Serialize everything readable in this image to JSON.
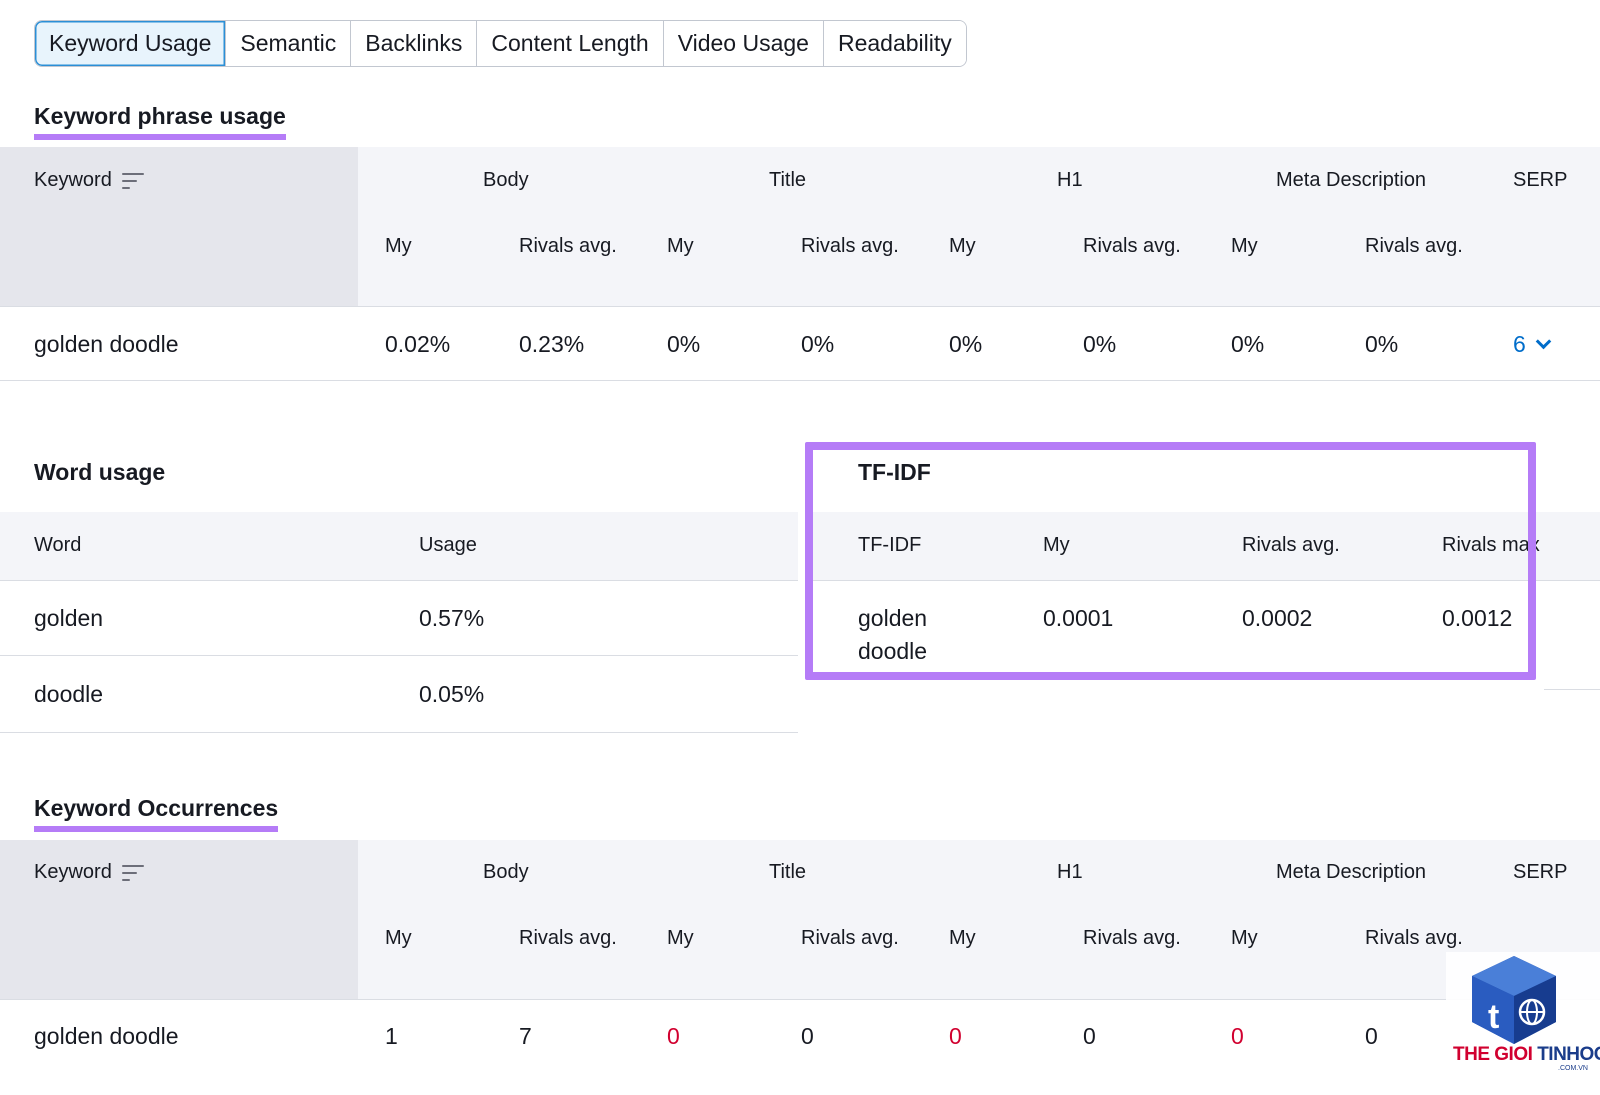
{
  "tabs": [
    "Keyword Usage",
    "Semantic",
    "Backlinks",
    "Content Length",
    "Video Usage",
    "Readability"
  ],
  "keyword_phrase_usage": {
    "title": "Keyword phrase usage",
    "keyword_header": "Keyword",
    "groups": [
      "Body",
      "Title",
      "H1",
      "Meta Description",
      "SERP"
    ],
    "sub": {
      "my": "My",
      "rivals": "Rivals avg."
    },
    "row": {
      "keyword": "golden doodle",
      "body_my": "0.02%",
      "body_rivals": "0.23%",
      "title_my": "0%",
      "title_rivals": "0%",
      "h1_my": "0%",
      "h1_rivals": "0%",
      "meta_my": "0%",
      "meta_rivals": "0%",
      "serp": "6"
    }
  },
  "word_usage": {
    "title": "Word usage",
    "headers": {
      "word": "Word",
      "usage": "Usage"
    },
    "rows": [
      {
        "word": "golden",
        "usage": "0.57%"
      },
      {
        "word": "doodle",
        "usage": "0.05%"
      }
    ]
  },
  "tfidf": {
    "title": "TF-IDF",
    "headers": {
      "term": "TF-IDF",
      "my": "My",
      "rivals_avg": "Rivals avg.",
      "rivals_max": "Rivals max"
    },
    "row": {
      "term_line1": "golden",
      "term_line2": "doodle",
      "my": "0.0001",
      "rivals_avg": "0.0002",
      "rivals_max": "0.0012"
    }
  },
  "keyword_occurrences": {
    "title": "Keyword Occurrences",
    "keyword_header": "Keyword",
    "groups": [
      "Body",
      "Title",
      "H1",
      "Meta Description",
      "SERP"
    ],
    "sub": {
      "my": "My",
      "rivals": "Rivals avg."
    },
    "row": {
      "keyword": "golden doodle",
      "body_my": "1",
      "body_rivals": "7",
      "title_my": "0",
      "title_rivals": "0",
      "h1_my": "0",
      "h1_rivals": "0",
      "meta_my": "0",
      "meta_rivals": "0"
    }
  },
  "watermark": {
    "word1": "THE GIOI",
    "word2": "TINHOC",
    "sub": ".COM.VN"
  },
  "colors": {
    "accent_purple": "#b57cf7",
    "link_blue": "#006dca",
    "zero_red": "#d1002f",
    "tab_active_bg": "#e8f4fc"
  },
  "icons": [
    "sort-icon",
    "chevron-down-icon",
    "cube-logo-icon"
  ]
}
